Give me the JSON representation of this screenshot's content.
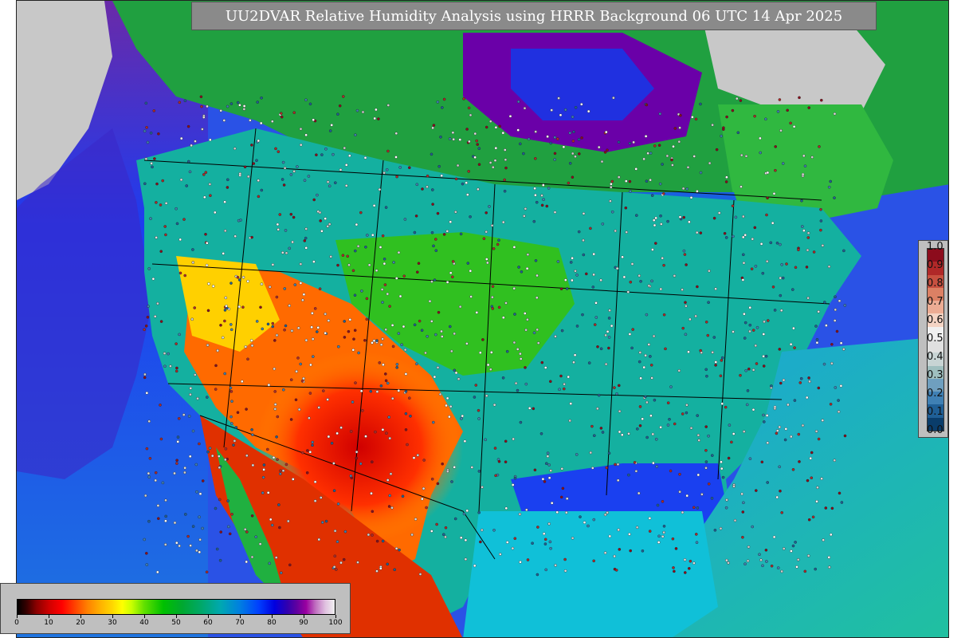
{
  "title": "UU2DVAR Relative Humidity Analysis using HRRR Background 06 UTC 14 Apr 2025",
  "colorbar": {
    "ticks": [
      "0",
      "10",
      "20",
      "30",
      "40",
      "50",
      "60",
      "70",
      "80",
      "90",
      "100"
    ],
    "colors": [
      "#000000",
      "#8b0000",
      "#ff0000",
      "#ff8000",
      "#ffff00",
      "#00c000",
      "#00a86a",
      "#0080e0",
      "#0000e0",
      "#9a00a0",
      "#f0f0f0"
    ]
  },
  "obs_legend": {
    "ticks": [
      "1.0",
      "0.9",
      "0.8",
      "0.7",
      "0.6",
      "0.5",
      "0.4",
      "0.3",
      "0.2",
      "0.1",
      "0.0"
    ],
    "colors": [
      "#0a3d6b",
      "#1f5f96",
      "#3f80b4",
      "#6f9fbf",
      "#9fbfbf",
      "#c8d4d4",
      "#e0e0e0",
      "#f0f0f0",
      "#f4d4c4",
      "#ecac94",
      "#dc8064",
      "#c85040",
      "#b02828",
      "#8c0c1c"
    ]
  },
  "map": {
    "ocean_color": "#1e6ed8",
    "background_color": "#c8c8c8"
  }
}
